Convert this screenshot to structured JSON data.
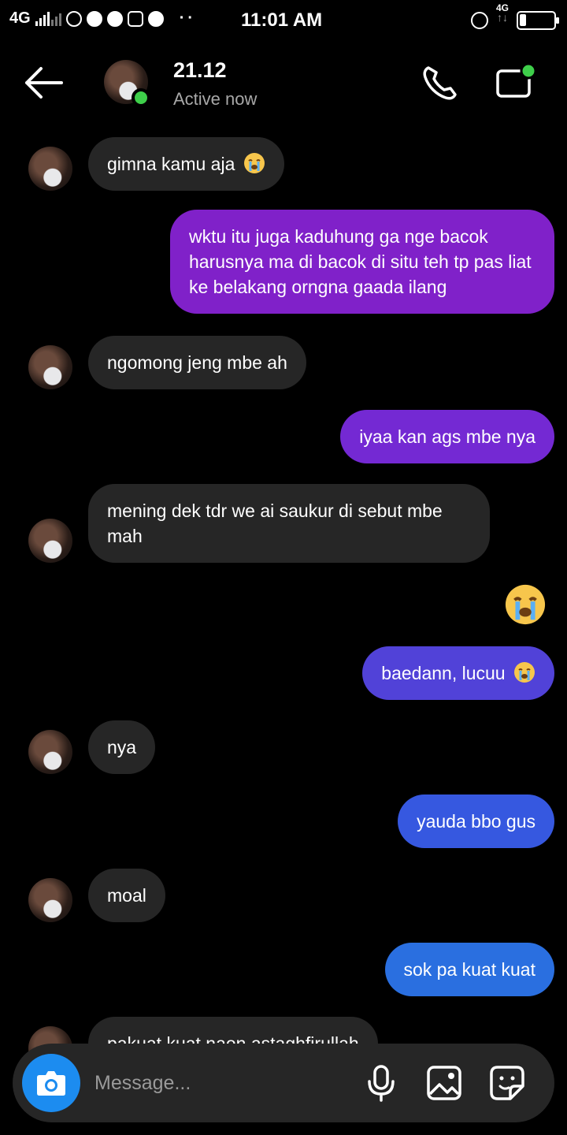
{
  "status_bar": {
    "network": "4G",
    "time": "11:01 AM",
    "data_label": "4G",
    "battery_level": 0.2
  },
  "header": {
    "contact_name": "21.12",
    "contact_status": "Active now",
    "back_icon": "arrow-left-icon",
    "call_icon": "phone-icon",
    "video_icon": "video-camera-icon"
  },
  "messages": [
    {
      "from": "them",
      "text": "gimna kamu aja",
      "emoji": "crying-face"
    },
    {
      "from": "me",
      "text": "wktu itu juga kaduhung ga nge bacok harusnya ma di bacok di situ teh tp pas liat ke belakang orngna gaada ilang"
    },
    {
      "from": "them",
      "text": "ngomong jeng mbe ah"
    },
    {
      "from": "me",
      "text": "iyaa kan ags mbe nya"
    },
    {
      "from": "them",
      "text": "mening dek tdr we ai saukur di sebut mbe mah"
    },
    {
      "from": "me",
      "text": "",
      "emoji": "crying-face"
    },
    {
      "from": "me",
      "text": "baedann, lucuu",
      "emoji": "crying-face"
    },
    {
      "from": "them",
      "text": "nya"
    },
    {
      "from": "me",
      "text": "yauda bbo gus"
    },
    {
      "from": "them",
      "text": "moal"
    },
    {
      "from": "me",
      "text": "sok pa kuat kuat"
    },
    {
      "from": "them",
      "text": "pakuat kuat naon astaghfirullah"
    }
  ],
  "composer": {
    "placeholder": "Message...",
    "camera_icon": "camera-icon",
    "mic_icon": "microphone-icon",
    "gallery_icon": "image-icon",
    "sticker_icon": "sticker-icon"
  },
  "colors": {
    "incoming_bubble": "#262626",
    "outgoing_purple": "#7e22ce",
    "outgoing_blue": "#2a6fe0",
    "online": "#3ecf4a",
    "camera_button": "#1c8cf0"
  }
}
